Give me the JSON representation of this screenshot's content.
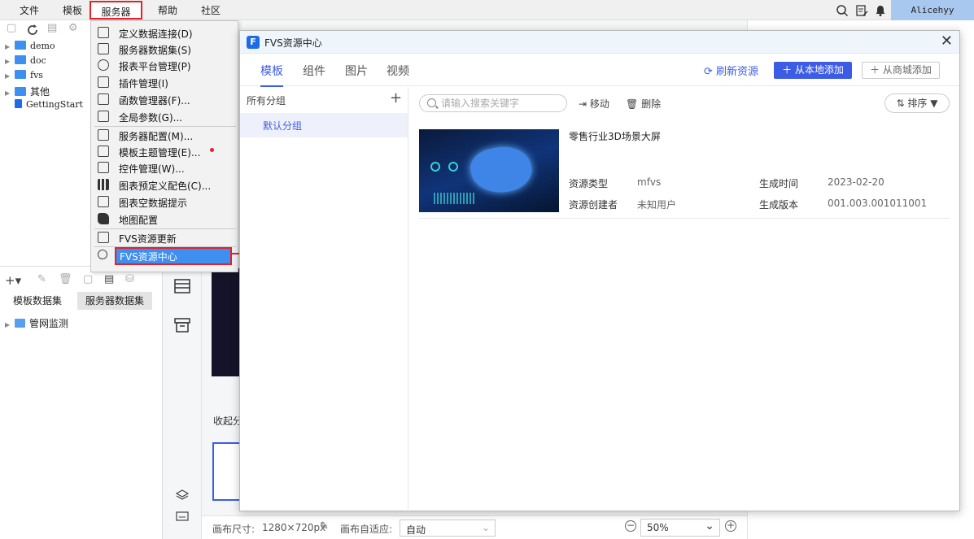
{
  "menubar": {
    "items": [
      "文件",
      "模板",
      "服务器",
      "帮助",
      "社区"
    ],
    "active": "服务器",
    "user": "Alicehyy"
  },
  "tree": {
    "items": [
      "demo",
      "doc",
      "fvs",
      "其他",
      "GettingStart"
    ]
  },
  "datasets": {
    "tabs": [
      "模板数据集",
      "服务器数据集"
    ],
    "items": [
      "管网监测"
    ]
  },
  "server_menu": {
    "items": [
      "定义数据连接(D)",
      "服务器数据集(S)",
      "报表平台管理(P)",
      "插件管理(I)",
      "函数管理器(F)...",
      "全局参数(G)...",
      "服务器配置(M)...",
      "模板主题管理(E)...",
      "控件管理(W)...",
      "图表预定义配色(C)...",
      "图表空数据提示",
      "地图配置",
      "FVS资源更新",
      "FVS资源中心"
    ],
    "highlighted": "FVS资源中心"
  },
  "dialog": {
    "title": "FVS资源中心",
    "tabs": [
      "模板",
      "组件",
      "图片",
      "视频"
    ],
    "active_tab": "模板",
    "refresh_label": "刷新资源",
    "add_local_label": "从本地添加",
    "add_store_label": "从商城添加",
    "groups_header": "所有分组",
    "groups": [
      "默认分组"
    ],
    "search_placeholder": "请输入搜索关键字",
    "move_label": "移动",
    "delete_label": "删除",
    "sort_label": "排序",
    "resource": {
      "name": "零售行业3D场景大屏",
      "type_label": "资源类型",
      "type_value": "mfvs",
      "creator_label": "资源创建者",
      "creator_value": "未知用户",
      "time_label": "生成时间",
      "time_value": "2023-02-20",
      "version_label": "生成版本",
      "version_value": "001.003.001011001"
    }
  },
  "canvas": {
    "collapse_label": "收起分",
    "size_label": "画布尺寸:",
    "size_value": "1280×720px",
    "adapt_label": "画布自适应:",
    "adapt_value": "自动",
    "zoom_value": "50%"
  },
  "colors": {
    "accent": "#3d5ce6",
    "highlight": "#e8202a",
    "selection": "#3d8ff0",
    "folder": "#3d8ff0"
  }
}
